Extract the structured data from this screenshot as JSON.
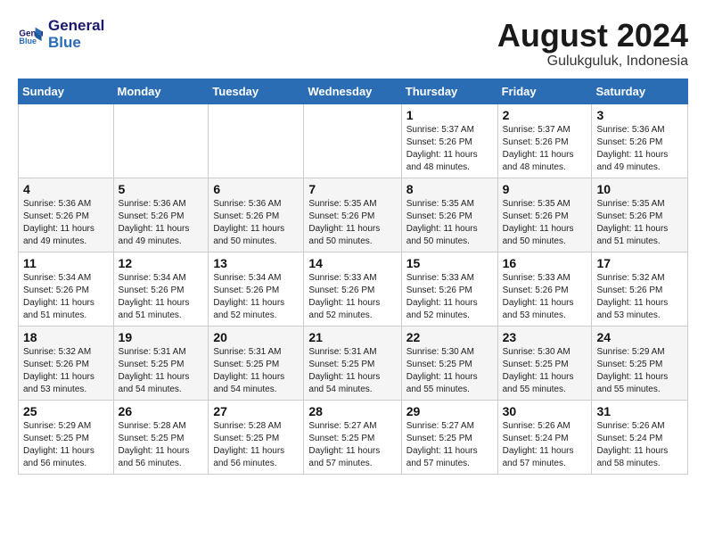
{
  "header": {
    "logo_line1": "General",
    "logo_line2": "Blue",
    "month": "August 2024",
    "location": "Gulukguluk, Indonesia"
  },
  "weekdays": [
    "Sunday",
    "Monday",
    "Tuesday",
    "Wednesday",
    "Thursday",
    "Friday",
    "Saturday"
  ],
  "weeks": [
    [
      {
        "day": "",
        "info": ""
      },
      {
        "day": "",
        "info": ""
      },
      {
        "day": "",
        "info": ""
      },
      {
        "day": "",
        "info": ""
      },
      {
        "day": "1",
        "info": "Sunrise: 5:37 AM\nSunset: 5:26 PM\nDaylight: 11 hours\nand 48 minutes."
      },
      {
        "day": "2",
        "info": "Sunrise: 5:37 AM\nSunset: 5:26 PM\nDaylight: 11 hours\nand 48 minutes."
      },
      {
        "day": "3",
        "info": "Sunrise: 5:36 AM\nSunset: 5:26 PM\nDaylight: 11 hours\nand 49 minutes."
      }
    ],
    [
      {
        "day": "4",
        "info": "Sunrise: 5:36 AM\nSunset: 5:26 PM\nDaylight: 11 hours\nand 49 minutes."
      },
      {
        "day": "5",
        "info": "Sunrise: 5:36 AM\nSunset: 5:26 PM\nDaylight: 11 hours\nand 49 minutes."
      },
      {
        "day": "6",
        "info": "Sunrise: 5:36 AM\nSunset: 5:26 PM\nDaylight: 11 hours\nand 50 minutes."
      },
      {
        "day": "7",
        "info": "Sunrise: 5:35 AM\nSunset: 5:26 PM\nDaylight: 11 hours\nand 50 minutes."
      },
      {
        "day": "8",
        "info": "Sunrise: 5:35 AM\nSunset: 5:26 PM\nDaylight: 11 hours\nand 50 minutes."
      },
      {
        "day": "9",
        "info": "Sunrise: 5:35 AM\nSunset: 5:26 PM\nDaylight: 11 hours\nand 50 minutes."
      },
      {
        "day": "10",
        "info": "Sunrise: 5:35 AM\nSunset: 5:26 PM\nDaylight: 11 hours\nand 51 minutes."
      }
    ],
    [
      {
        "day": "11",
        "info": "Sunrise: 5:34 AM\nSunset: 5:26 PM\nDaylight: 11 hours\nand 51 minutes."
      },
      {
        "day": "12",
        "info": "Sunrise: 5:34 AM\nSunset: 5:26 PM\nDaylight: 11 hours\nand 51 minutes."
      },
      {
        "day": "13",
        "info": "Sunrise: 5:34 AM\nSunset: 5:26 PM\nDaylight: 11 hours\nand 52 minutes."
      },
      {
        "day": "14",
        "info": "Sunrise: 5:33 AM\nSunset: 5:26 PM\nDaylight: 11 hours\nand 52 minutes."
      },
      {
        "day": "15",
        "info": "Sunrise: 5:33 AM\nSunset: 5:26 PM\nDaylight: 11 hours\nand 52 minutes."
      },
      {
        "day": "16",
        "info": "Sunrise: 5:33 AM\nSunset: 5:26 PM\nDaylight: 11 hours\nand 53 minutes."
      },
      {
        "day": "17",
        "info": "Sunrise: 5:32 AM\nSunset: 5:26 PM\nDaylight: 11 hours\nand 53 minutes."
      }
    ],
    [
      {
        "day": "18",
        "info": "Sunrise: 5:32 AM\nSunset: 5:26 PM\nDaylight: 11 hours\nand 53 minutes."
      },
      {
        "day": "19",
        "info": "Sunrise: 5:31 AM\nSunset: 5:25 PM\nDaylight: 11 hours\nand 54 minutes."
      },
      {
        "day": "20",
        "info": "Sunrise: 5:31 AM\nSunset: 5:25 PM\nDaylight: 11 hours\nand 54 minutes."
      },
      {
        "day": "21",
        "info": "Sunrise: 5:31 AM\nSunset: 5:25 PM\nDaylight: 11 hours\nand 54 minutes."
      },
      {
        "day": "22",
        "info": "Sunrise: 5:30 AM\nSunset: 5:25 PM\nDaylight: 11 hours\nand 55 minutes."
      },
      {
        "day": "23",
        "info": "Sunrise: 5:30 AM\nSunset: 5:25 PM\nDaylight: 11 hours\nand 55 minutes."
      },
      {
        "day": "24",
        "info": "Sunrise: 5:29 AM\nSunset: 5:25 PM\nDaylight: 11 hours\nand 55 minutes."
      }
    ],
    [
      {
        "day": "25",
        "info": "Sunrise: 5:29 AM\nSunset: 5:25 PM\nDaylight: 11 hours\nand 56 minutes."
      },
      {
        "day": "26",
        "info": "Sunrise: 5:28 AM\nSunset: 5:25 PM\nDaylight: 11 hours\nand 56 minutes."
      },
      {
        "day": "27",
        "info": "Sunrise: 5:28 AM\nSunset: 5:25 PM\nDaylight: 11 hours\nand 56 minutes."
      },
      {
        "day": "28",
        "info": "Sunrise: 5:27 AM\nSunset: 5:25 PM\nDaylight: 11 hours\nand 57 minutes."
      },
      {
        "day": "29",
        "info": "Sunrise: 5:27 AM\nSunset: 5:25 PM\nDaylight: 11 hours\nand 57 minutes."
      },
      {
        "day": "30",
        "info": "Sunrise: 5:26 AM\nSunset: 5:24 PM\nDaylight: 11 hours\nand 57 minutes."
      },
      {
        "day": "31",
        "info": "Sunrise: 5:26 AM\nSunset: 5:24 PM\nDaylight: 11 hours\nand 58 minutes."
      }
    ]
  ]
}
